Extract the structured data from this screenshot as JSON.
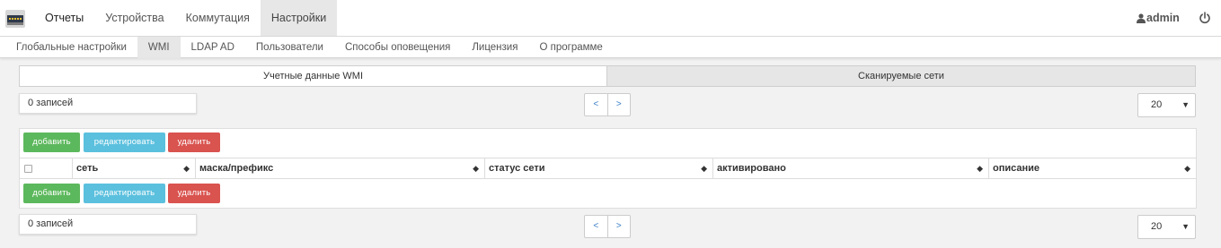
{
  "topnav": {
    "items": [
      "Отчеты",
      "Устройства",
      "Коммутация",
      "Настройки"
    ],
    "active": "Настройки",
    "user": "admin"
  },
  "subnav": {
    "items": [
      "Глобальные настройки",
      "WMI",
      "LDAP AD",
      "Пользователи",
      "Способы оповещения",
      "Лицензия",
      "О программе"
    ],
    "active": "WMI"
  },
  "tabs": {
    "credentials": "Учетные данные WMI",
    "networks": "Сканируемые сети",
    "active": "Учетные данные WMI"
  },
  "pagination": {
    "records_label": "0 записей",
    "prev": "<",
    "next": ">",
    "page_size": "20"
  },
  "toolbar": {
    "add": "добавить",
    "edit": "редактировать",
    "delete": "удалить"
  },
  "table": {
    "columns": [
      "сеть",
      "маска/префикс",
      "статус сети",
      "активировано",
      "описание"
    ]
  },
  "colors": {
    "add": "#5cb85c",
    "edit": "#5bc0de",
    "delete": "#d9534f",
    "link": "#3a7ec7"
  },
  "icons": {
    "logo": "app-logo-icon",
    "user": "user-icon",
    "power": "power-icon",
    "sort": "sort-icon",
    "dropdown": "caret-down-icon"
  }
}
